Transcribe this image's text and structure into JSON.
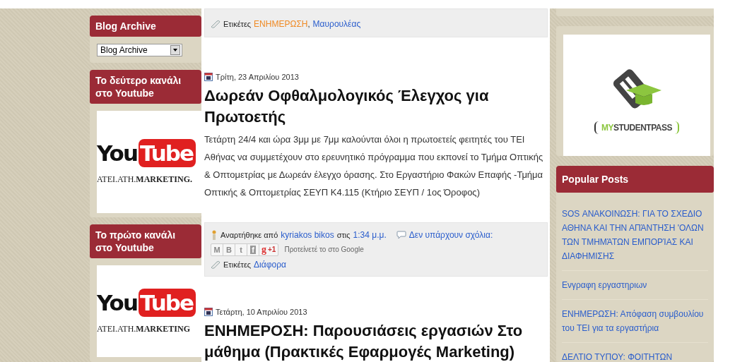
{
  "left_sidebar": [
    {
      "kind": "archive",
      "title": "Blog Archive",
      "select": "Blog Archive"
    },
    {
      "kind": "youtube",
      "title": "Το δεύτερο κανάλι στο Youtube",
      "logo_you": "You",
      "logo_tube": "Tube",
      "caption": "ATEI.ATH.**MARKETING.**"
    },
    {
      "kind": "youtube",
      "title": "Το πρώτο κανάλι στο Youtube",
      "logo_you": "You",
      "logo_tube": "Tube",
      "caption": "ATEI.ATH.**MARKETING**"
    }
  ],
  "posts": [
    {
      "kind": "footer",
      "labels_label": "Ετικέτες",
      "labels": [
        {
          "text": "ΕΝΗΜΕΡΩΣΗ",
          "after": ",",
          "color": "#f08a24"
        },
        {
          "text": "Μαυρουλέας",
          "color": "#2a5dcc"
        }
      ]
    },
    {
      "kind": "full",
      "date": "Τρίτη, 23 Απριλίου 2013",
      "title": "Δωρεάν Οφθαλμολογικός Έλεγχος για Πρωτοετής",
      "body": "Τετάρτη 24/4 και ώρα 3μμ με 7μμ καλούνται όλοι η πρωτοετείς φειτητές του ΤΕΙ Αθήνας να συμμετέχουν στο ερευνητικό πρόγραμμα που εκπονεί το Τμήμα Οπτικής & Οπτομετρίας με Δωρεάν έλεγχο όρασης. Στο Εργαστήριο Φακών Επαφής -Τμήμα Οπτικής & Οπτομετρίας ΣΕΥΠ Κ4.115 (Κτήριο ΣΕΥΠ / 1ος Όροφος)",
      "posted_by": "Αναρτήθηκε από",
      "author": "kyriakos bikos",
      "at": "στις",
      "time": "1:34 μ.μ.",
      "comments": "Δεν υπάρχουν σχόλια:",
      "share": [
        {
          "kind": "email",
          "glyph": "M"
        },
        {
          "kind": "blog",
          "glyph": "B"
        },
        {
          "kind": "twitter",
          "glyph": "t"
        },
        {
          "kind": "facebook",
          "glyph": "f"
        },
        {
          "kind": "gplus",
          "glyph": "g",
          "count": "+1"
        }
      ],
      "recommend": "Προτείνετέ το στο Google",
      "labels_label": "Ετικέτες",
      "labels": [
        {
          "text": "Διάφορα",
          "color": "#2a5dcc"
        }
      ]
    },
    {
      "kind": "head",
      "date": "Τετάρτη, 10 Απριλίου 2013",
      "title": "ΕΝΗΜΕΡΟΣΗ: Παρουσιάσεις εργασιών Στο μάθημα (Πρακτικές Εφαρμογές Marketing)"
    }
  ],
  "right_sidebar": [
    {
      "kind": "stub"
    },
    {
      "kind": "mystudentpass",
      "brand_my": "MY",
      "brand_rest": "STUDENTPASS"
    },
    {
      "kind": "popular",
      "title": "Popular Posts",
      "items": [
        "SOS ΑΝΑΚΟΙΝΩΣΗ: ΓΙΑ ΤΟ ΣΧΕΔΙΟ ΑΘΗΝΑ ΚΑΙ ΤΗΝ ΑΠΆΝΤΗΣΗ 'ΟΛΩΝ ΤΩΝ ΤΜΗΜΆΤΩΝ ΕΜΠΟΡΊΑΣ ΚΑΙ ΔΙΑΦΗΜΙΣΗΣ",
        "Ενγραφη εργαστηριων",
        "ΕΝΗΜΕΡΩΣΗ: Απόφαση συμβουλίου του ΤΕΙ για τα εργαστήρια",
        "ΔΕΛΤΙΟ ΤΥΠΟΥ: ΦΟΙΤΗΤΩΝ"
      ]
    }
  ]
}
